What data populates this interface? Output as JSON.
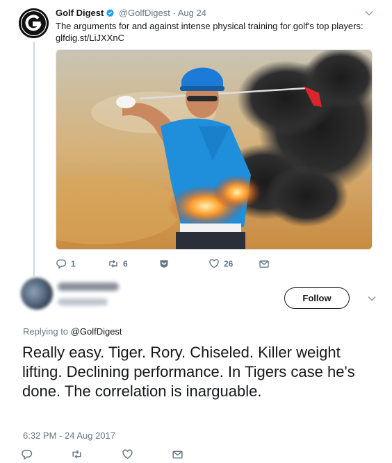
{
  "parent_tweet": {
    "name": "Golf Digest",
    "handle": "@GolfDigest",
    "separator": "·",
    "date": "Aug 24",
    "text": "The arguments for and against intense physical training for golf's top players:",
    "link": "glfdig.st/LiJXXnC",
    "avatar_icon": "golf-digest-g-logo",
    "verified_icon": "verified-badge-icon",
    "actions": {
      "reply_count": "1",
      "retweet_count": "6",
      "like_count": "26"
    }
  },
  "reply_tweet": {
    "follow_label": "Follow",
    "replying_prefix": "Replying to ",
    "replying_handle": "@GolfDigest",
    "text": "Really easy. Tiger. Rory. Chiseled. Killer weight lifting. Declining performance. In Tigers case he's done. The correlation is inarguable.",
    "timestamp": "6:32 PM - 24 Aug 2017"
  },
  "colors": {
    "text": "#14171a",
    "muted": "#657786",
    "verified": "#1da1f2",
    "border": "#e1e8ed",
    "thread_line": "#ccd6dd"
  }
}
